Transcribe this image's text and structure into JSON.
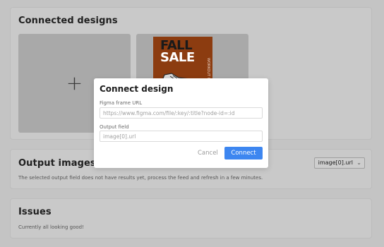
{
  "connected_designs": {
    "title": "Connected designs",
    "add_icon": "plus-icon",
    "design": {
      "poster_line1": "FALL",
      "poster_line2": "SALE",
      "poster_side": "WORKOUT CLOTHES",
      "poster_color": "#8c3c10",
      "icon": "shoe-icon"
    }
  },
  "output_images": {
    "title": "Output images",
    "message": "The selected output field does not have results yet, process the feed and refresh in a few minutes.",
    "select_value": "image[0].url",
    "select_icon": "chevron-down-icon"
  },
  "issues": {
    "title": "Issues",
    "message": "Currently all looking good!"
  },
  "modal": {
    "title": "Connect design",
    "url_label": "Figma frame URL",
    "url_placeholder": "https://www.figma.com/file/:key/:title?node-id=:id",
    "output_label": "Output field",
    "output_placeholder": "image[0].url",
    "cancel_label": "Cancel",
    "connect_label": "Connect",
    "accent_color": "#3d86f0"
  }
}
